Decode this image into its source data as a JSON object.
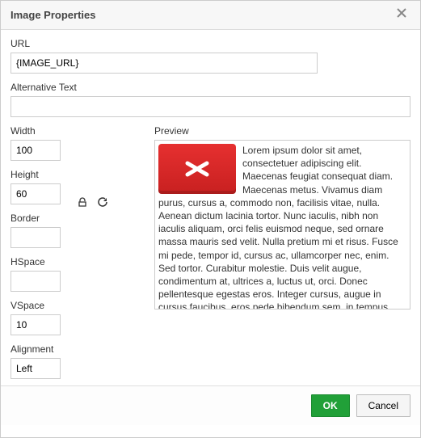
{
  "dialog": {
    "title": "Image Properties"
  },
  "fields": {
    "url_label": "URL",
    "url_value": "{IMAGE_URL}",
    "alt_label": "Alternative Text",
    "alt_value": "",
    "width_label": "Width",
    "width_value": "100",
    "height_label": "Height",
    "height_value": "60",
    "border_label": "Border",
    "border_value": "",
    "hspace_label": "HSpace",
    "hspace_value": "",
    "vspace_label": "VSpace",
    "vspace_value": "10",
    "alignment_label": "Alignment",
    "alignment_value": "Left"
  },
  "preview": {
    "label": "Preview",
    "text": "Lorem ipsum dolor sit amet, consectetuer adipiscing elit. Maecenas feugiat consequat diam. Maecenas metus. Vivamus diam purus, cursus a, commodo non, facilisis vitae, nulla. Aenean dictum lacinia tortor. Nunc iaculis, nibh non iaculis aliquam, orci felis euismod neque, sed ornare massa mauris sed velit. Nulla pretium mi et risus. Fusce mi pede, tempor id, cursus ac, ullamcorper nec, enim. Sed tortor. Curabitur molestie. Duis velit augue, condimentum at, ultrices a, luctus ut, orci. Donec pellentesque egestas eros. Integer cursus, augue in cursus faucibus, eros pede bibendum sem, in tempus"
  },
  "buttons": {
    "ok": "OK",
    "cancel": "Cancel"
  }
}
